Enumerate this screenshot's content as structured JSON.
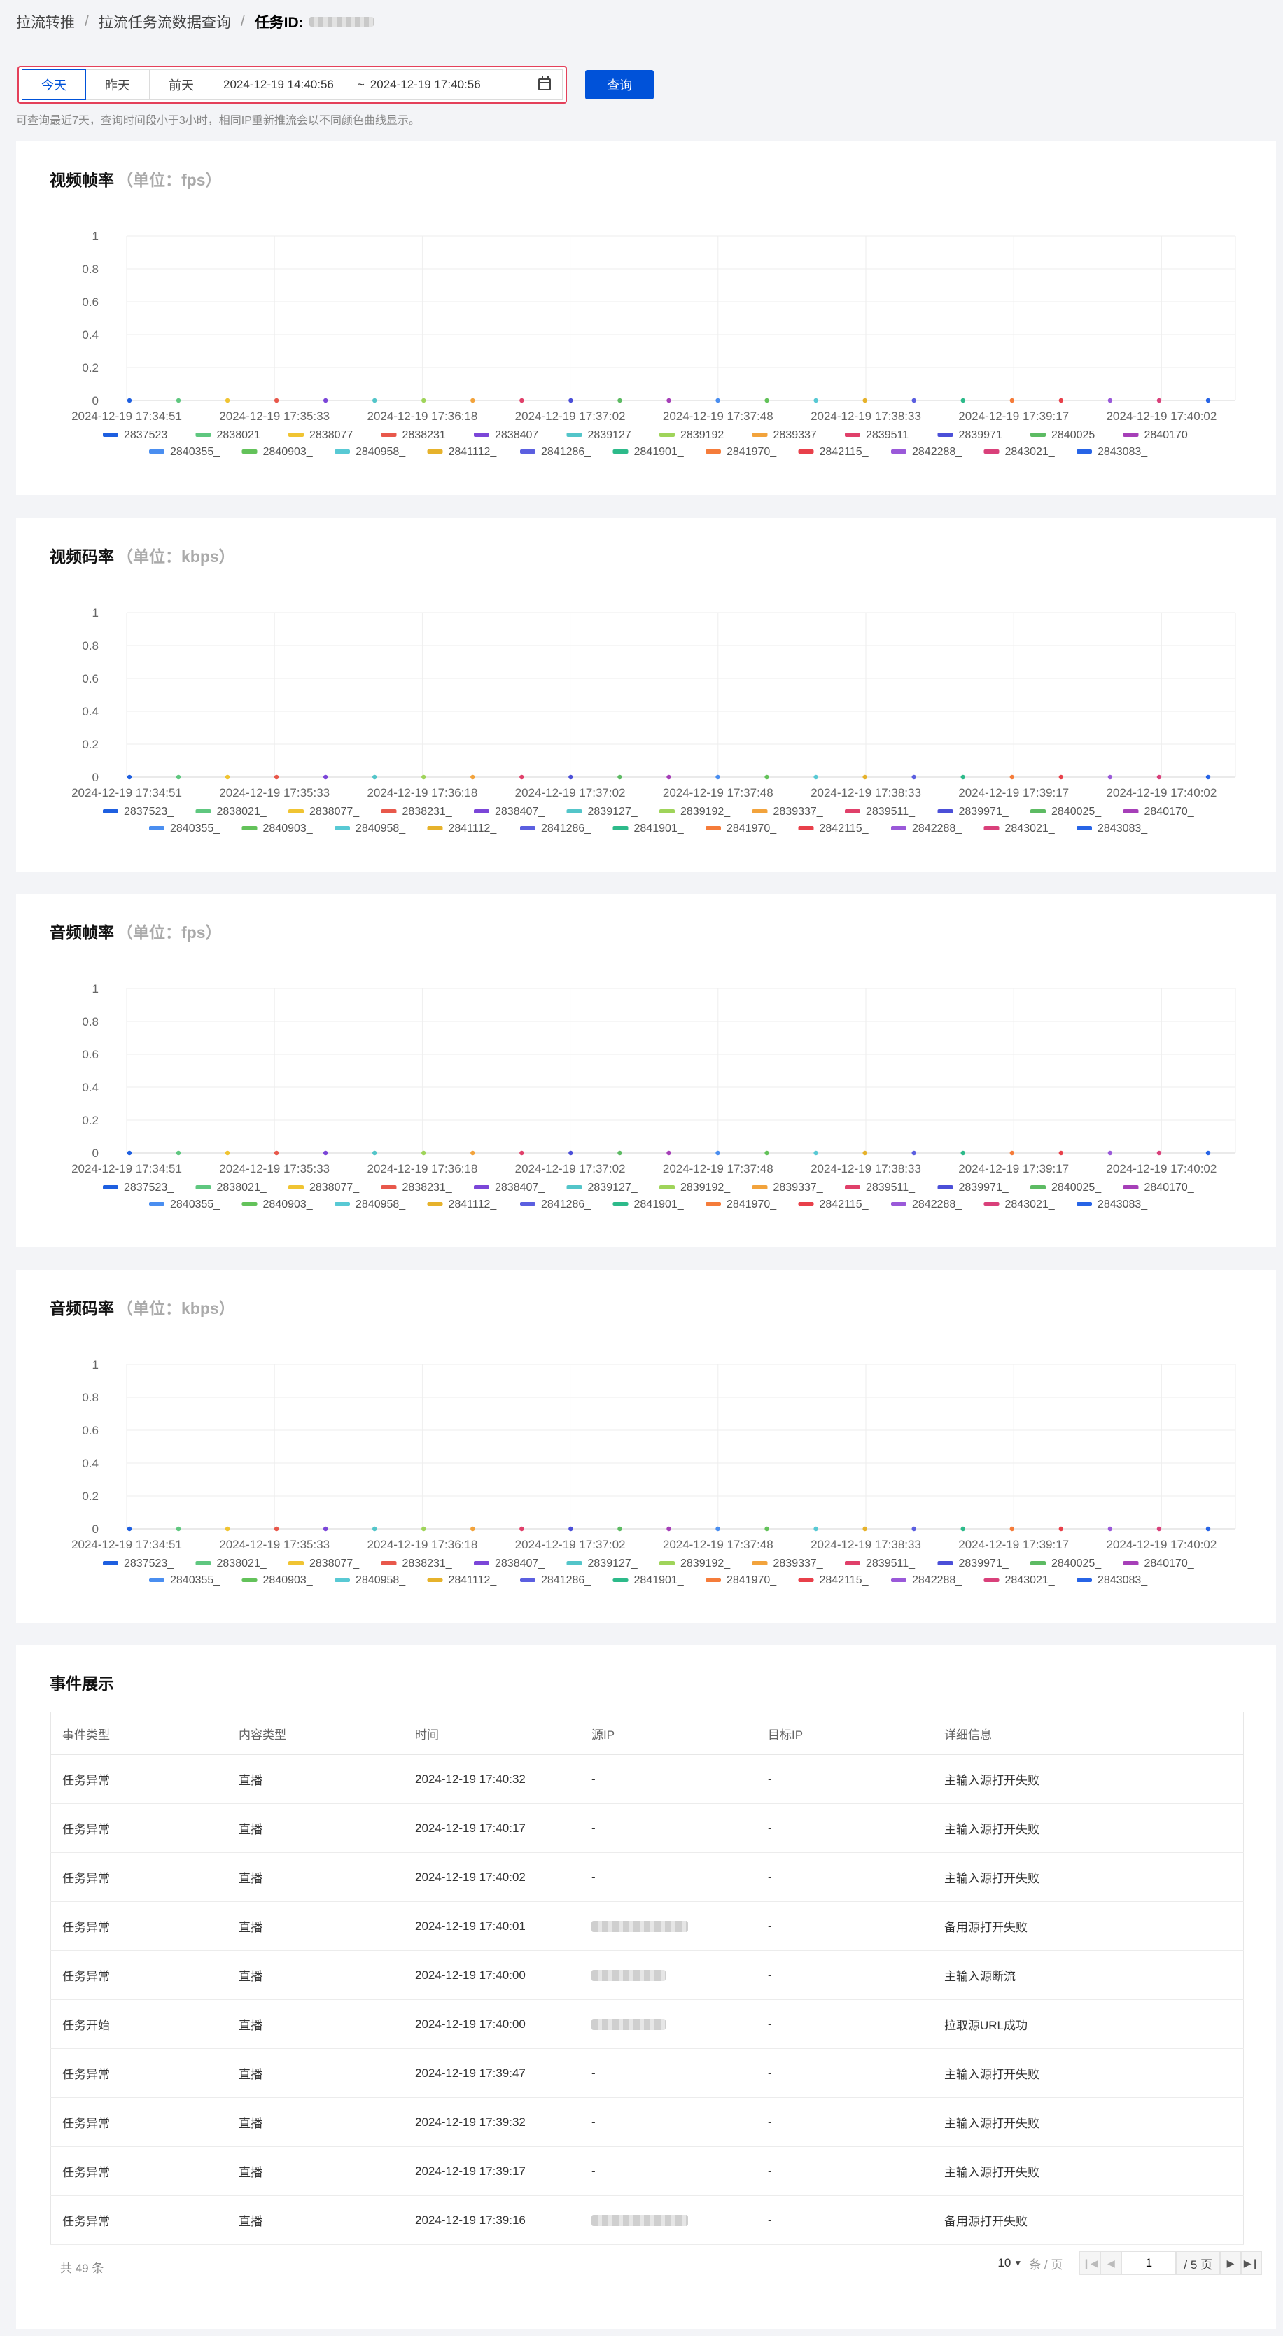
{
  "breadcrumb": {
    "item1": "拉流转推",
    "item2": "拉流任务流数据查询",
    "current": "任务ID:"
  },
  "filter": {
    "today": "今天",
    "yesterday": "昨天",
    "day_before": "前天",
    "start": "2024-12-19 14:40:56",
    "separator": "~",
    "end": "2024-12-19 17:40:56",
    "query_button": "查询",
    "hint": "可查询最近7天，查询时间段小于3小时，相同IP重新推流会以不同颜色曲线显示。"
  },
  "charts_common": {
    "yticks": [
      "0",
      "0.2",
      "0.4",
      "0.6",
      "0.8",
      "1"
    ],
    "xticks": [
      "2024-12-19 17:34:51",
      "2024-12-19 17:35:33",
      "2024-12-19 17:36:18",
      "2024-12-19 17:37:02",
      "2024-12-19 17:37:48",
      "2024-12-19 17:38:33",
      "2024-12-19 17:39:17",
      "2024-12-19 17:40:02"
    ],
    "series": [
      {
        "name": "2837523_",
        "color": "#1e5fe0"
      },
      {
        "name": "2838021_",
        "color": "#5fc77f"
      },
      {
        "name": "2838077_",
        "color": "#f0c432"
      },
      {
        "name": "2838231_",
        "color": "#e8584b"
      },
      {
        "name": "2838407_",
        "color": "#7b46d8"
      },
      {
        "name": "2839127_",
        "color": "#53c5c9"
      },
      {
        "name": "2839192_",
        "color": "#9fd45a"
      },
      {
        "name": "2839337_",
        "color": "#f2a33c"
      },
      {
        "name": "2839511_",
        "color": "#e0406a"
      },
      {
        "name": "2839971_",
        "color": "#4b4fd8"
      },
      {
        "name": "2840025_",
        "color": "#5dbb63"
      },
      {
        "name": "2840170_",
        "color": "#a63fb8"
      },
      {
        "name": "2840355_",
        "color": "#4a8ef0"
      },
      {
        "name": "2840903_",
        "color": "#63c25a"
      },
      {
        "name": "2840958_",
        "color": "#58c9d4"
      },
      {
        "name": "2841112_",
        "color": "#e6b22b"
      },
      {
        "name": "2841286_",
        "color": "#5b5fe0"
      },
      {
        "name": "2841901_",
        "color": "#2dba8a"
      },
      {
        "name": "2841970_",
        "color": "#f57c3a"
      },
      {
        "name": "2842115_",
        "color": "#e8404a"
      },
      {
        "name": "2842288_",
        "color": "#9a59d9"
      },
      {
        "name": "2843021_",
        "color": "#d9407a"
      },
      {
        "name": "2843083_",
        "color": "#2764e6"
      }
    ]
  },
  "chart_data": [
    {
      "type": "line",
      "title": "视频帧率",
      "unit_label": "（单位：fps）",
      "ylim": [
        0,
        1
      ],
      "x": [
        "2024-12-19 17:34:51",
        "2024-12-19 17:35:33",
        "2024-12-19 17:36:18",
        "2024-12-19 17:37:02",
        "2024-12-19 17:37:48",
        "2024-12-19 17:38:33",
        "2024-12-19 17:39:17",
        "2024-12-19 17:40:02"
      ],
      "all_values": 0,
      "grid": true,
      "legend": "bottom"
    },
    {
      "type": "line",
      "title": "视频码率",
      "unit_label": "（单位：kbps）",
      "ylim": [
        0,
        1
      ],
      "x": [
        "2024-12-19 17:34:51",
        "2024-12-19 17:35:33",
        "2024-12-19 17:36:18",
        "2024-12-19 17:37:02",
        "2024-12-19 17:37:48",
        "2024-12-19 17:38:33",
        "2024-12-19 17:39:17",
        "2024-12-19 17:40:02"
      ],
      "all_values": 0,
      "grid": true,
      "legend": "bottom"
    },
    {
      "type": "line",
      "title": "音频帧率",
      "unit_label": "（单位：fps）",
      "ylim": [
        0,
        1
      ],
      "x": [
        "2024-12-19 17:34:51",
        "2024-12-19 17:35:33",
        "2024-12-19 17:36:18",
        "2024-12-19 17:37:02",
        "2024-12-19 17:37:48",
        "2024-12-19 17:38:33",
        "2024-12-19 17:39:17",
        "2024-12-19 17:40:02"
      ],
      "all_values": 0,
      "grid": true,
      "legend": "bottom"
    },
    {
      "type": "line",
      "title": "音频码率",
      "unit_label": "（单位：kbps）",
      "ylim": [
        0,
        1
      ],
      "x": [
        "2024-12-19 17:34:51",
        "2024-12-19 17:35:33",
        "2024-12-19 17:36:18",
        "2024-12-19 17:37:02",
        "2024-12-19 17:37:48",
        "2024-12-19 17:38:33",
        "2024-12-19 17:39:17",
        "2024-12-19 17:40:02"
      ],
      "all_values": 0,
      "grid": true,
      "legend": "bottom"
    }
  ],
  "events": {
    "title": "事件展示",
    "columns": [
      "事件类型",
      "内容类型",
      "时间",
      "源IP",
      "目标IP",
      "详细信息"
    ],
    "rows": [
      [
        "任务异常",
        "直播",
        "2024-12-19 17:40:32",
        "-",
        "-",
        "主输入源打开失败"
      ],
      [
        "任务异常",
        "直播",
        "2024-12-19 17:40:17",
        "-",
        "-",
        "主输入源打开失败"
      ],
      [
        "任务异常",
        "直播",
        "2024-12-19 17:40:02",
        "-",
        "-",
        "主输入源打开失败"
      ],
      [
        "任务异常",
        "直播",
        "2024-12-19 17:40:01",
        "",
        "-",
        "备用源打开失败"
      ],
      [
        "任务异常",
        "直播",
        "2024-12-19 17:40:00",
        "",
        "-",
        "主输入源断流"
      ],
      [
        "任务开始",
        "直播",
        "2024-12-19 17:40:00",
        "",
        "-",
        "拉取源URL成功"
      ],
      [
        "任务异常",
        "直播",
        "2024-12-19 17:39:47",
        "-",
        "-",
        "主输入源打开失败"
      ],
      [
        "任务异常",
        "直播",
        "2024-12-19 17:39:32",
        "-",
        "-",
        "主输入源打开失败"
      ],
      [
        "任务异常",
        "直播",
        "2024-12-19 17:39:17",
        "-",
        "-",
        "主输入源打开失败"
      ],
      [
        "任务异常",
        "直播",
        "2024-12-19 17:39:16",
        "",
        "-",
        "备用源打开失败"
      ]
    ]
  },
  "pagination": {
    "total": "共 49 条",
    "page_size": "10",
    "page_size_unit": "条 / 页",
    "current_page": "1",
    "total_pages": "/ 5 页"
  }
}
